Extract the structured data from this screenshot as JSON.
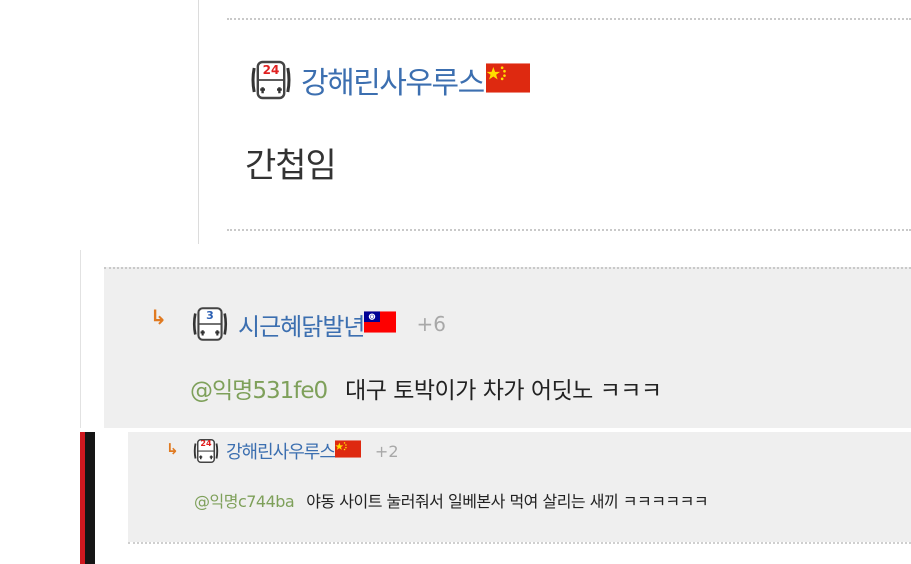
{
  "comment1": {
    "author": "강해린사우루스",
    "author_flag": "china-flag-icon",
    "level_badge": "24",
    "body": "간첩임"
  },
  "reply1": {
    "arrow": "↳",
    "author": "시근혜닭발년",
    "author_flag": "taiwan-flag-icon",
    "level_badge": "3",
    "score": "+6",
    "mention": "@익명531fe0",
    "body": "대구 토박이가 차가 어딧노 ㅋㅋㅋ"
  },
  "reply2": {
    "arrow": "↳",
    "author": "강해린사우루스",
    "author_flag": "china-flag-icon",
    "level_badge": "24",
    "score": "+2",
    "mention": "@익명c744ba",
    "body": "야동 사이트 눌러줘서 일베본사 먹여 살리는 새끼 ㅋㅋㅋㅋㅋㅋ"
  },
  "colors": {
    "author_blue": "#3c6fb0",
    "mention_green": "#7ea05a",
    "reply_arrow_orange": "#e07a21",
    "score_gray": "#a8a8a8",
    "panel_gray": "#efefef"
  }
}
